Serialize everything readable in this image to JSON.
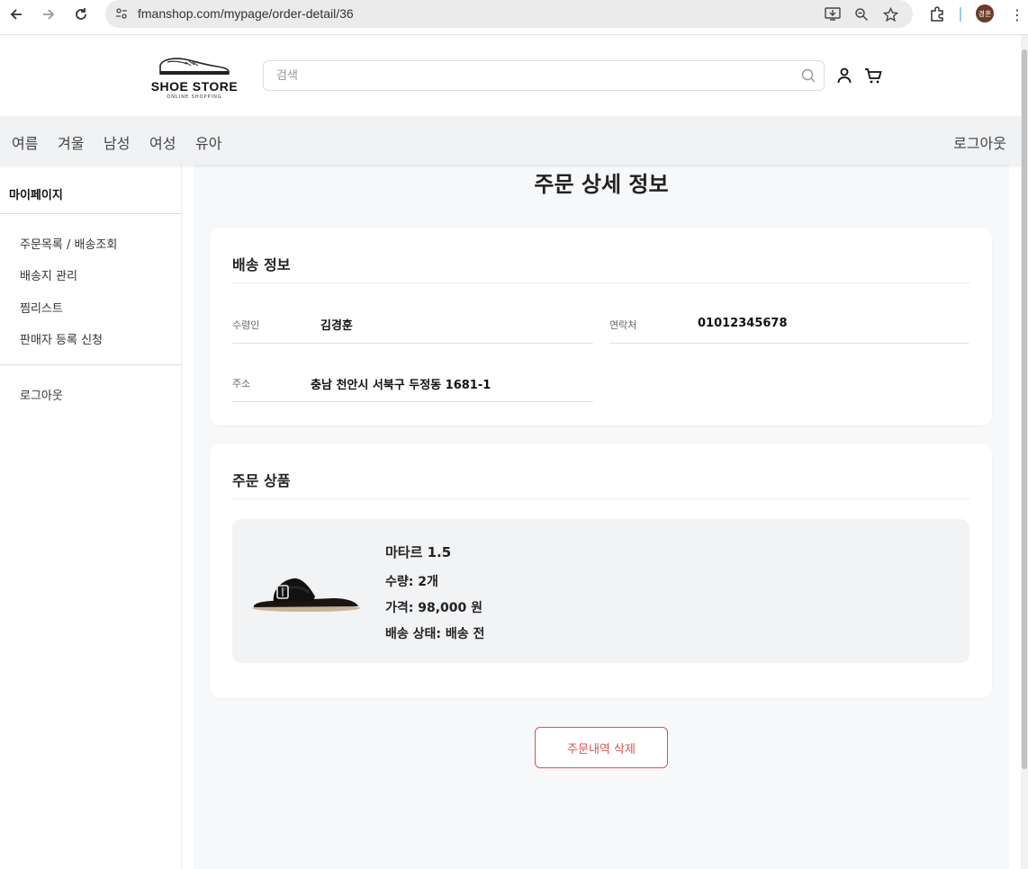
{
  "browser": {
    "url": "fmanshop.com/mypage/order-detail/36",
    "profile_initials": "경훈",
    "icons": [
      "back-icon",
      "forward-icon",
      "reload-icon",
      "site-info-icon",
      "install-icon",
      "zoom-icon",
      "bookmark-star-icon",
      "extensions-icon",
      "menu-kebab-icon"
    ]
  },
  "header": {
    "logo_title": "SHOE STORE",
    "logo_sub": "ONLINE SHOPPING",
    "search_placeholder": "검색"
  },
  "nav": {
    "categories": [
      "여름",
      "겨울",
      "남성",
      "여성",
      "유아"
    ],
    "logout": "로그아웃"
  },
  "sidebar": {
    "title": "마이페이지",
    "items": [
      "주문목록 / 배송조회",
      "배송지 관리",
      "찜리스트",
      "판매자 등록 신청"
    ],
    "logout": "로그아웃"
  },
  "main": {
    "page_title": "주문 상세 정보",
    "shipping": {
      "title": "배송 정보",
      "recipient_label": "수령인",
      "recipient_value": "김경훈",
      "phone_label": "연락처",
      "phone_value": "01012345678",
      "address_label": "주소",
      "address_value": "충남 천안시 서북구 두정동 1681-1"
    },
    "order": {
      "title": "주문 상품",
      "product_name": "마타르 1.5",
      "quantity": "수량: 2개",
      "price": "가격: 98,000 원",
      "status": "배송 상태: 배송 전"
    },
    "delete_button": "주문내역 삭제"
  },
  "colors": {
    "accent_red": "#d9534f",
    "nav_bg": "#f1f2f4",
    "main_bg": "#f7f8fa"
  }
}
